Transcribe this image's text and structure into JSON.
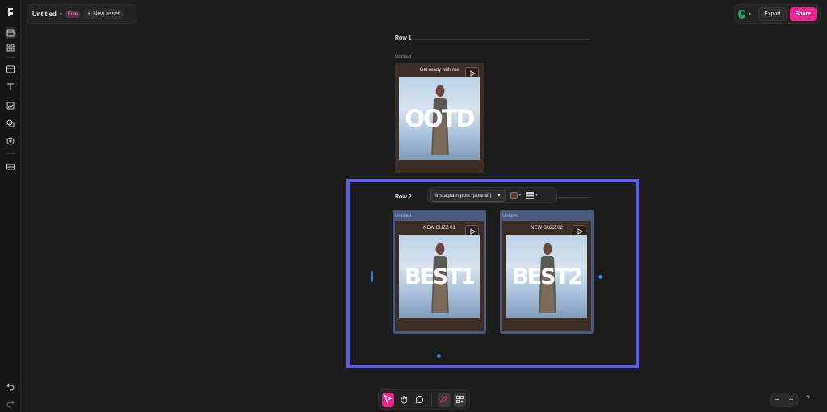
{
  "app": {
    "doc_title": "Untitled",
    "plan_badge": "Free",
    "new_asset_label": "New asset",
    "export_label": "Export",
    "share_label": "Share"
  },
  "rows": [
    {
      "label": "Row 1",
      "frames": [
        {
          "label": "Untitled",
          "caption": "Get ready with me",
          "big_text": "OOTD"
        }
      ]
    },
    {
      "label": "Row 2",
      "frames": [
        {
          "label": "Untitled",
          "caption": "NEW BUZZ 01",
          "big_text": "BEST1"
        },
        {
          "label": "Untitled",
          "caption": "NEW BUZZ 02",
          "big_text": "BEST2"
        }
      ]
    }
  ],
  "floating_toolbar": {
    "format_value": "Instagram post (portrait)",
    "fill_color": "#5b3a30"
  },
  "colors": {
    "accent": "#e9268f",
    "selection": "#5b5bf0",
    "handle": "#2e7fe6"
  },
  "icons": {
    "rail": [
      "layers-icon",
      "grid-icon",
      "layout-icon",
      "text-icon",
      "image-icon",
      "shapes-icon",
      "record-icon",
      "media-icon",
      "undo-icon",
      "redo-icon"
    ],
    "bottom": [
      "pointer-icon",
      "hand-icon",
      "comment-icon",
      "pen-icon",
      "qr-icon"
    ]
  },
  "zoom": {
    "minus": "−",
    "plus": "+"
  },
  "help_label": "?"
}
